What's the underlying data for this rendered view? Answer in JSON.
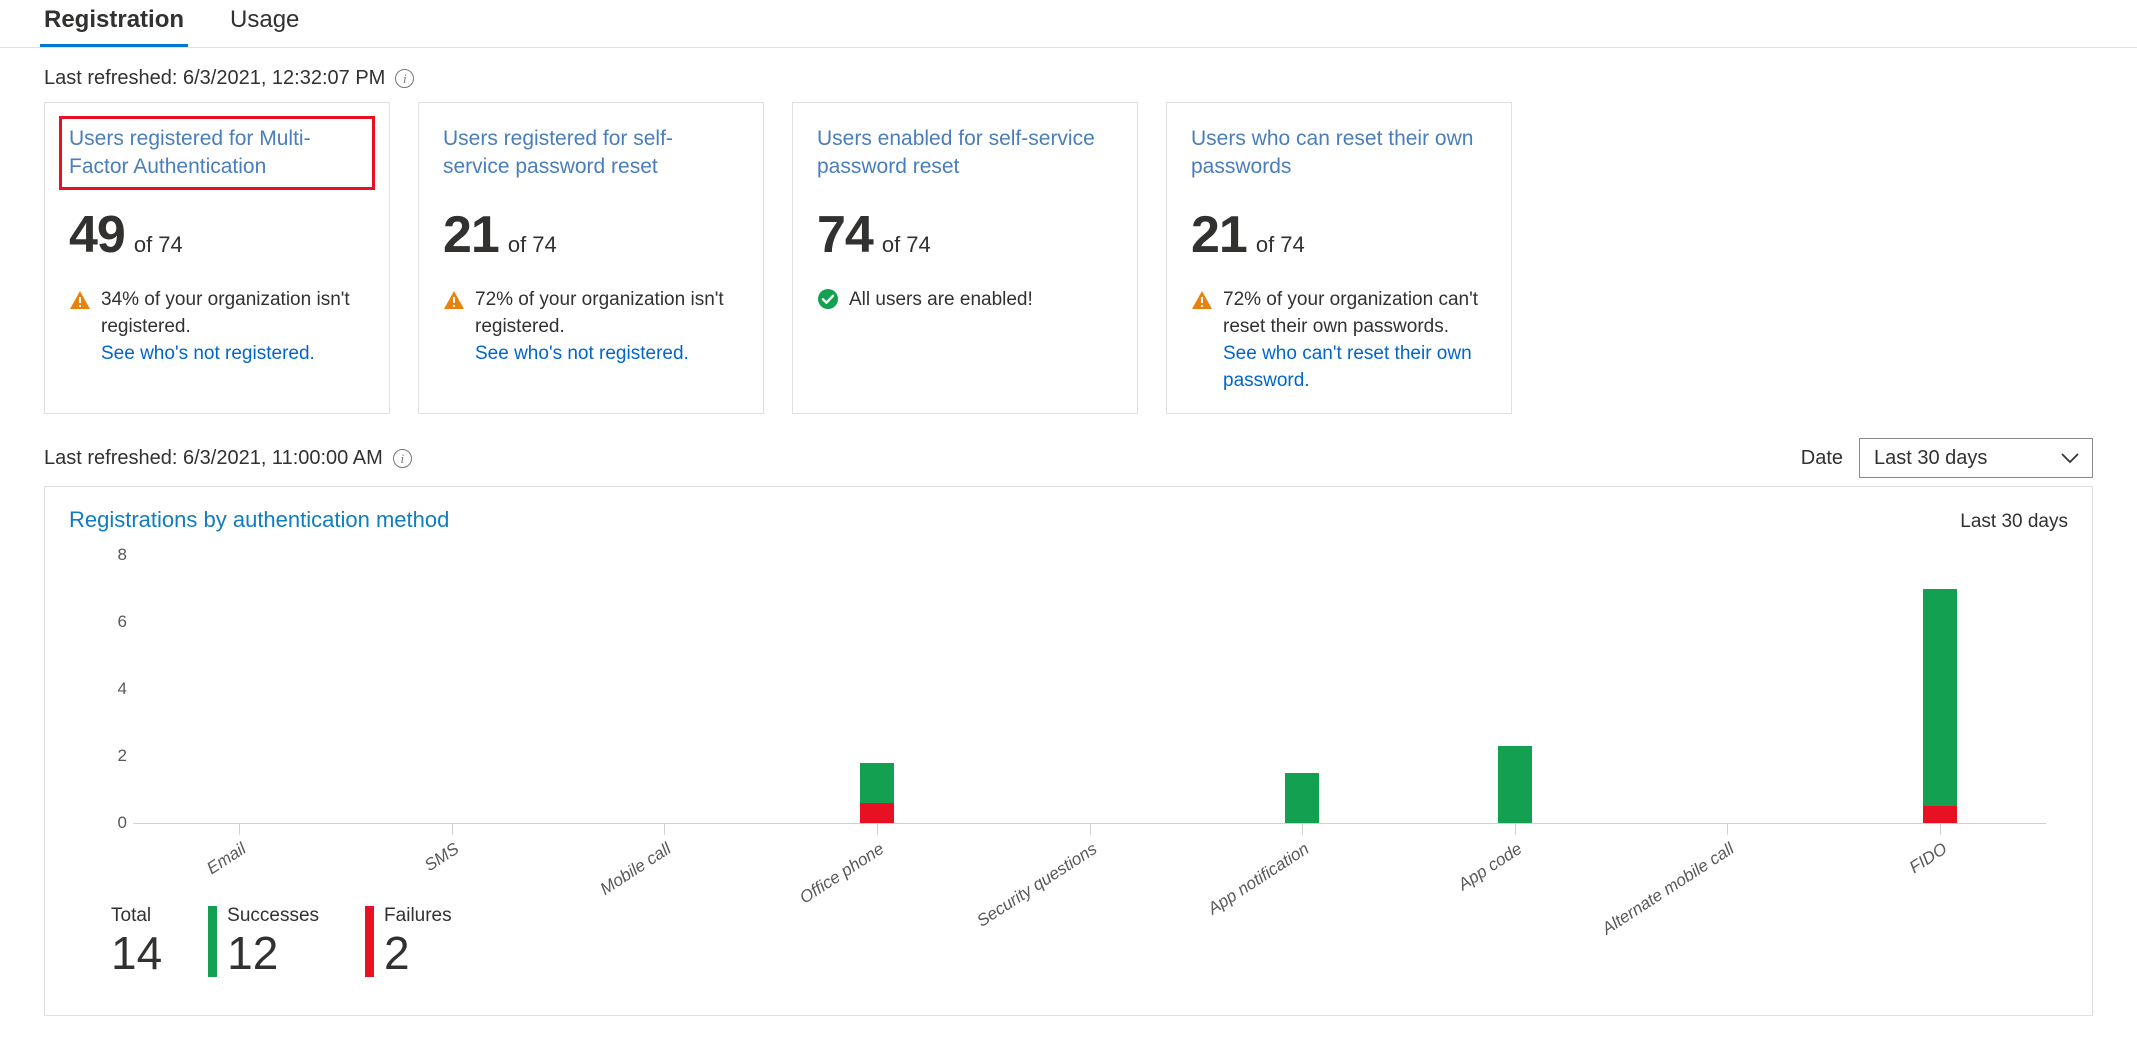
{
  "tabs": [
    {
      "label": "Registration",
      "active": true
    },
    {
      "label": "Usage",
      "active": false
    }
  ],
  "refresh_top": {
    "text": "Last refreshed: 6/3/2021, 12:32:07 PM",
    "info_glyph": "i"
  },
  "refresh_bottom": {
    "text": "Last refreshed: 6/3/2021, 11:00:00 AM",
    "info_glyph": "i"
  },
  "cards": [
    {
      "title": "Users registered for Multi-Factor Authentication",
      "value": "49",
      "of": "of 74",
      "status": "warning",
      "note": "34% of your organization isn't registered.",
      "link": "See who's not registered.",
      "highlighted": true
    },
    {
      "title": "Users registered for self-service password reset",
      "value": "21",
      "of": "of 74",
      "status": "warning",
      "note": "72% of your organization isn't registered.",
      "link": "See who's not registered.",
      "highlighted": false
    },
    {
      "title": "Users enabled for self-service password reset",
      "value": "74",
      "of": "of 74",
      "status": "ok",
      "note": "All users are enabled!",
      "link": "",
      "highlighted": false
    },
    {
      "title": "Users who can reset their own passwords",
      "value": "21",
      "of": "of 74",
      "status": "warning",
      "note": "72% of your organization can't reset their own passwords.",
      "link": "See who can't reset their own password.",
      "highlighted": false
    }
  ],
  "date_filter": {
    "label": "Date",
    "value": "Last 30 days"
  },
  "chart_panel": {
    "title": "Registrations by authentication method",
    "range": "Last 30 days"
  },
  "summary": [
    {
      "label": "Total",
      "value": "14",
      "color": ""
    },
    {
      "label": "Successes",
      "value": "12",
      "color": "#13a050"
    },
    {
      "label": "Failures",
      "value": "2",
      "color": "#e81123"
    }
  ],
  "colors": {
    "accent": "#0078d4",
    "link": "#0066cc",
    "success": "#13a050",
    "failure": "#e81123",
    "warning": "#e8820c",
    "highlight": "#e81123"
  },
  "chart_data": {
    "type": "bar",
    "stacked": true,
    "title": "Registrations by authentication method",
    "xlabel": "",
    "ylabel": "",
    "ylim": [
      0,
      8
    ],
    "yticks": [
      0,
      2,
      4,
      6,
      8
    ],
    "grid": false,
    "legend_position": "bottom-left",
    "categories": [
      "Email",
      "SMS",
      "Mobile call",
      "Office phone",
      "Security questions",
      "App notification",
      "App code",
      "Alternate mobile call",
      "FIDO"
    ],
    "series": [
      {
        "name": "Successes",
        "color": "#13a050",
        "values": [
          0,
          0,
          0,
          1.2,
          0,
          1.5,
          2.3,
          0,
          6.5
        ]
      },
      {
        "name": "Failures",
        "color": "#e81123",
        "values": [
          0,
          0,
          0,
          0.6,
          0,
          0,
          0,
          0,
          0.5
        ]
      }
    ],
    "totals": {
      "total": 14,
      "successes": 12,
      "failures": 2
    }
  }
}
